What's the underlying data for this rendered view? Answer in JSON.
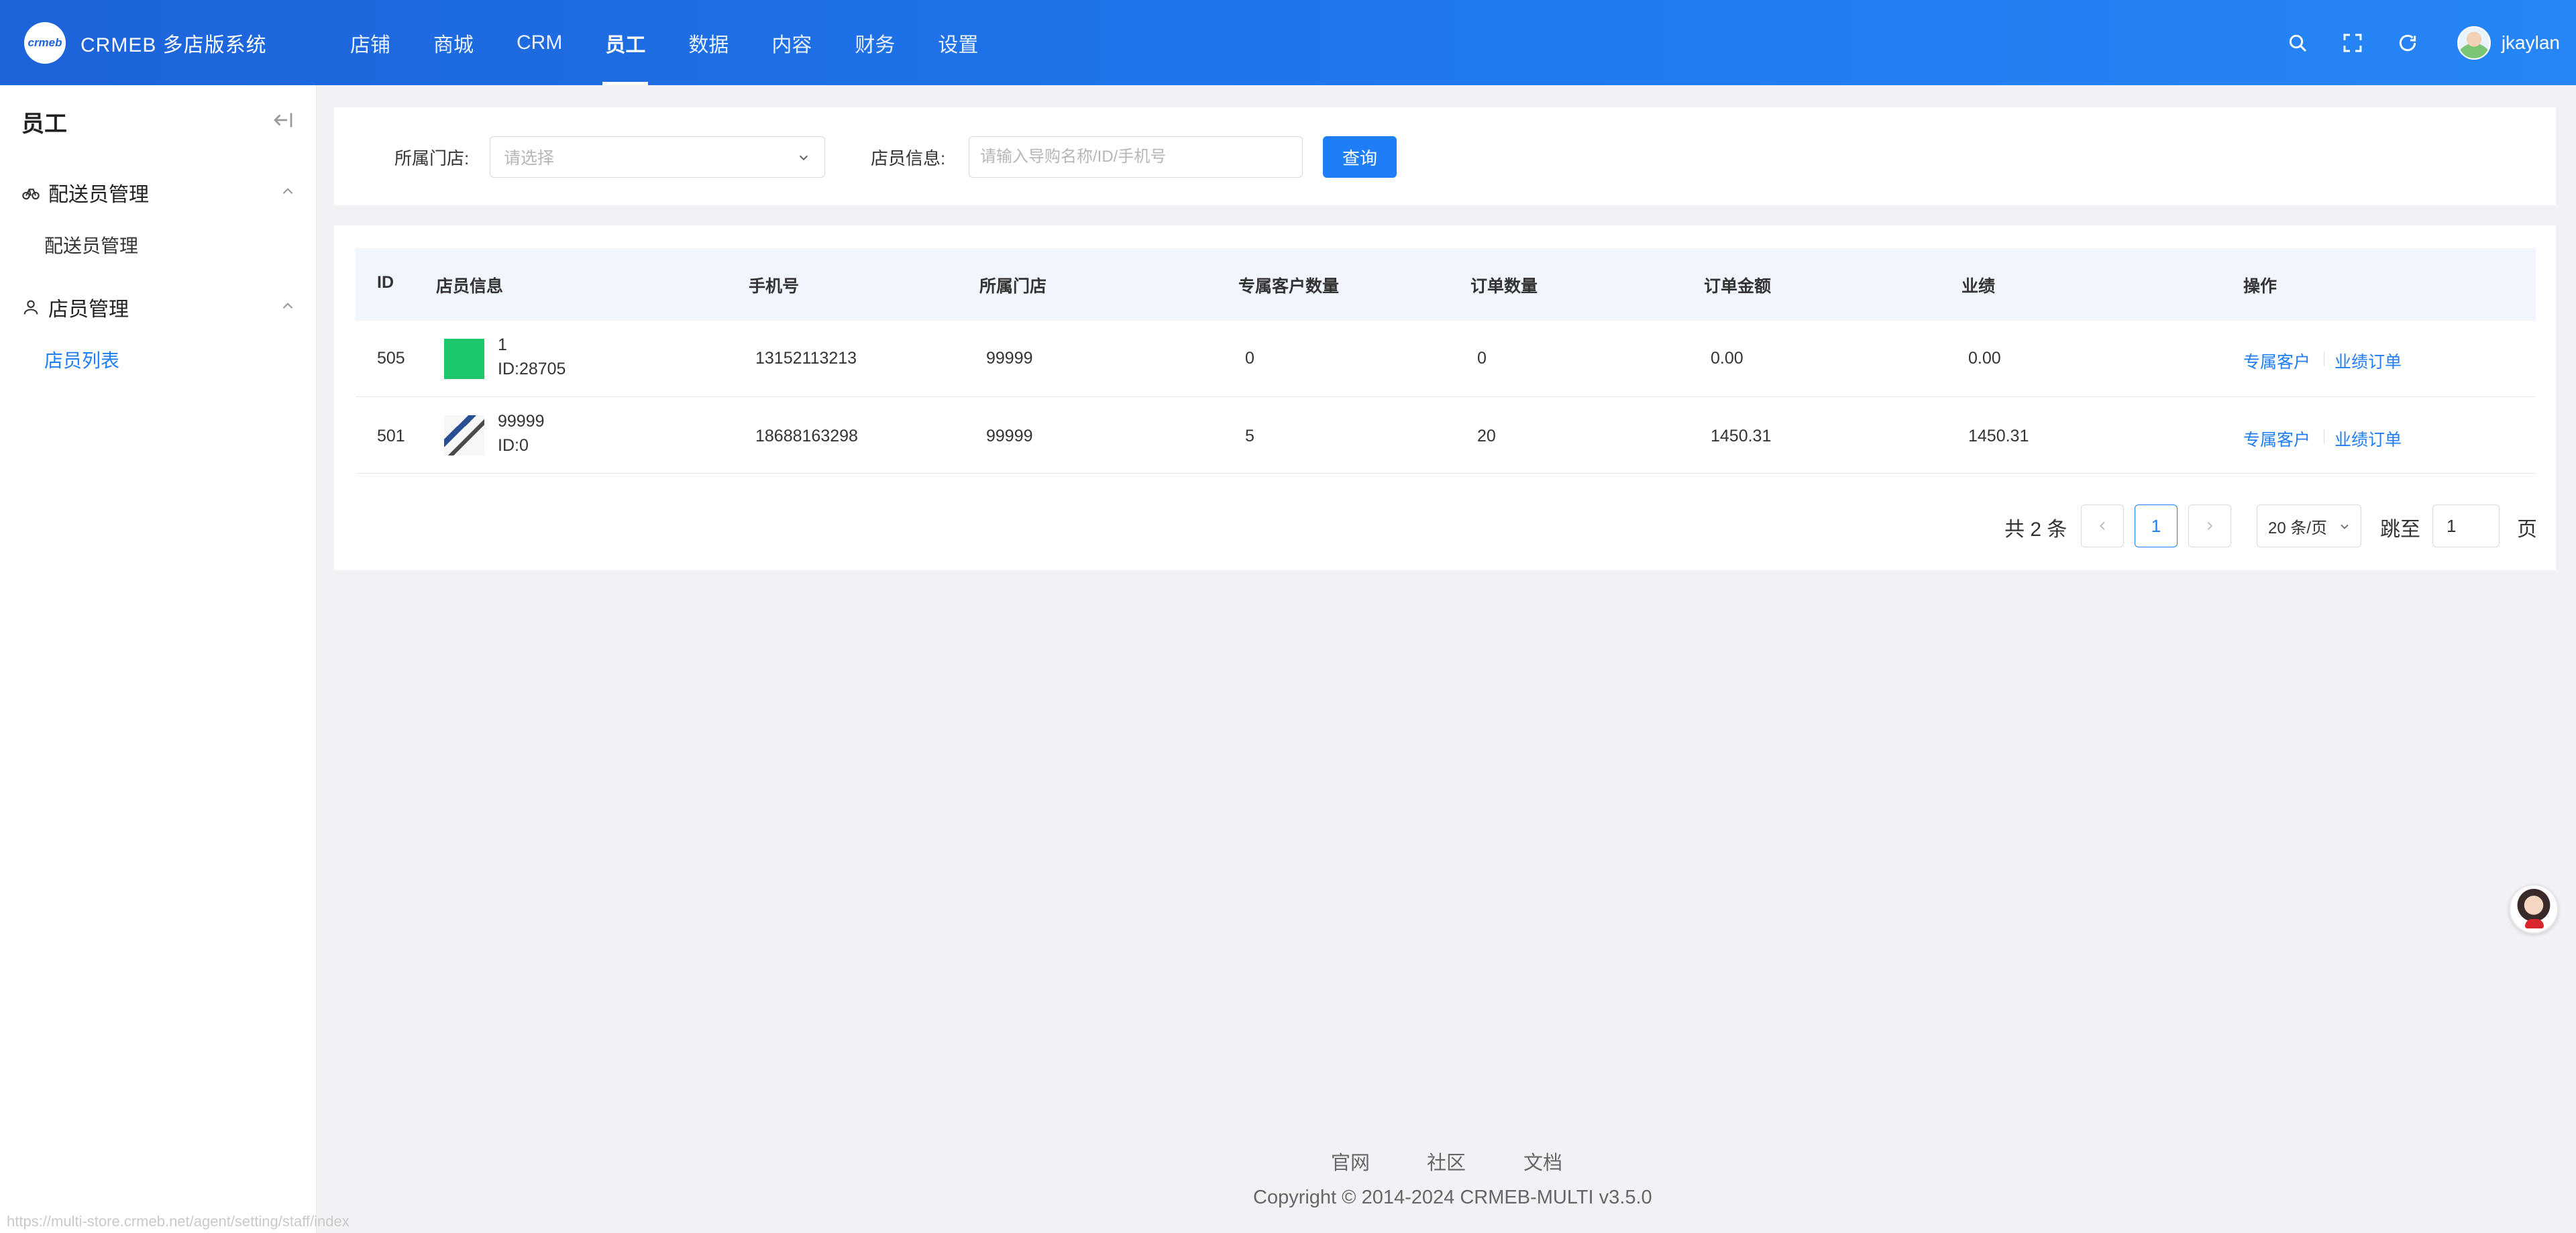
{
  "header": {
    "brand_logo_text": "crmeb",
    "brand_name": "CRMEB 多店版系统",
    "nav": [
      "店铺",
      "商城",
      "CRM",
      "员工",
      "数据",
      "内容",
      "财务",
      "设置"
    ],
    "active_nav": "员工",
    "icons": [
      "search-icon",
      "fullscreen-icon",
      "refresh-icon"
    ],
    "username": "jkaylan"
  },
  "sidebar": {
    "title": "员工",
    "groups": [
      {
        "label": "配送员管理",
        "icon": "bicycle-icon",
        "items": [
          "配送员管理"
        ]
      },
      {
        "label": "店员管理",
        "icon": "user-icon",
        "items": [
          "店员列表"
        ]
      }
    ],
    "active_item": "店员列表"
  },
  "filter": {
    "store_label": "所属门店:",
    "store_placeholder": "请选择",
    "staff_label": "店员信息:",
    "staff_placeholder": "请输入导购名称/ID/手机号",
    "query_button": "查询"
  },
  "table": {
    "columns": [
      "ID",
      "店员信息",
      "手机号",
      "所属门店",
      "专属客户数量",
      "订单数量",
      "订单金额",
      "业绩",
      "操作"
    ],
    "rows": [
      {
        "id": "505",
        "name": "1",
        "uid": "ID:28705",
        "phone": "13152113213",
        "store": "99999",
        "customers": "0",
        "orders": "0",
        "amount": "0.00",
        "performance": "0.00",
        "thumb": "green"
      },
      {
        "id": "501",
        "name": "99999",
        "uid": "ID:0",
        "phone": "18688163298",
        "store": "99999",
        "customers": "5",
        "orders": "20",
        "amount": "1450.31",
        "performance": "1450.31",
        "thumb": "image"
      }
    ],
    "actions": [
      "专属客户",
      "业绩订单"
    ]
  },
  "pagination": {
    "total": "共 2 条",
    "current_page": "1",
    "page_size": "20 条/页",
    "jump_label": "跳至",
    "jump_value": "1",
    "page_suffix": "页"
  },
  "footer": {
    "links": [
      "官网",
      "社区",
      "文档"
    ],
    "copyright": "Copyright © 2014-2024 CRMEB-MULTI v3.5.0"
  },
  "status_url": "https://multi-store.crmeb.net/agent/setting/staff/index",
  "colors": {
    "primary": "#1e7ef5",
    "header_start": "#1d63d9",
    "header_end": "#2786f7",
    "thumb_green": "#1cc86a"
  }
}
